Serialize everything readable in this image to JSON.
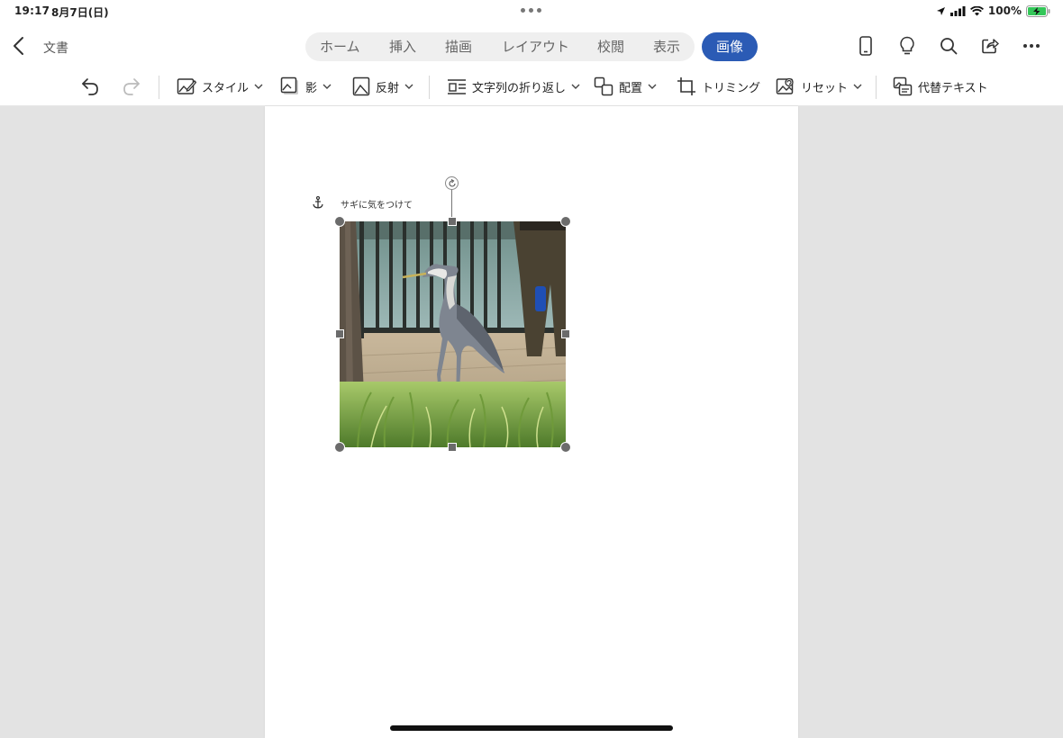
{
  "status_bar": {
    "time": "19:17",
    "date": "8月7日(日)",
    "battery": "100%"
  },
  "header": {
    "document_title": "文書",
    "tabs": [
      {
        "label": "ホーム"
      },
      {
        "label": "挿入"
      },
      {
        "label": "描画"
      },
      {
        "label": "レイアウト"
      },
      {
        "label": "校閲"
      },
      {
        "label": "表示"
      }
    ],
    "active_tab": "画像",
    "accent_color": "#2b5bb5"
  },
  "ribbon": {
    "style_label": "スタイル",
    "shadow_label": "影",
    "reflection_label": "反射",
    "wrap_text_label": "文字列の折り返し",
    "arrange_label": "配置",
    "crop_label": "トリミング",
    "reset_label": "リセット",
    "alt_text_label": "代替テキスト"
  },
  "document": {
    "caption": "サギに気をつけて"
  }
}
